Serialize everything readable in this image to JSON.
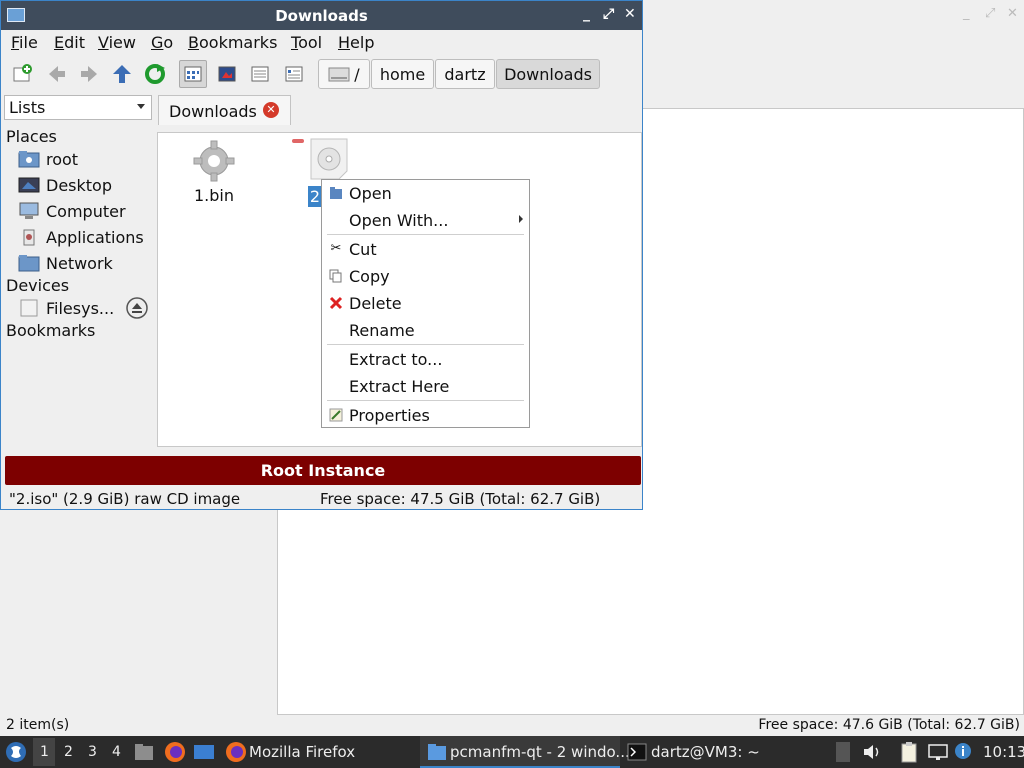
{
  "window": {
    "title": "Downloads",
    "controls": [
      "_",
      "⤢",
      "✕"
    ]
  },
  "menubar": [
    "File",
    "Edit",
    "View",
    "Go",
    "Bookmarks",
    "Tool",
    "Help"
  ],
  "menubar_mnemonic": [
    "F",
    "E",
    "V",
    "G",
    "B",
    "T",
    "H"
  ],
  "pathbar": {
    "root": "/",
    "crumbs": [
      "home",
      "dartz",
      "Downloads"
    ]
  },
  "sidepane": {
    "combo": "Lists",
    "places_header": "Places",
    "places": [
      "root",
      "Desktop",
      "Computer",
      "Applications",
      "Network"
    ],
    "devices_header": "Devices",
    "devices": [
      "Filesys..."
    ],
    "bookmarks_header": "Bookmarks"
  },
  "tab": {
    "label": "Downloads"
  },
  "files": [
    {
      "name": "1.bin",
      "icon": "gear-file-icon"
    },
    {
      "name": "2",
      "icon": "cd-image-icon",
      "selected": true
    }
  ],
  "context_menu": {
    "items": [
      "Open",
      "Open With...",
      "Cut",
      "Copy",
      "Delete",
      "Rename",
      "Extract to...",
      "Extract Here",
      "Properties"
    ]
  },
  "banner": "Root Instance",
  "status": {
    "left": "\"2.iso\" (2.9 GiB) raw CD image",
    "right": "Free space: 47.5 GiB (Total: 62.7 GiB)"
  },
  "bg_window": {
    "status_left": "2 item(s)",
    "status_right": "Free space: 47.6 GiB (Total: 62.7 GiB)"
  },
  "taskbar": {
    "workspaces": [
      "1",
      "2",
      "3",
      "4"
    ],
    "tasks": [
      "Mozilla Firefox",
      "pcmanfm-qt - 2 windo...",
      "dartz@VM3: ~"
    ],
    "clock": "10:13"
  },
  "colors": {
    "titlebar": "#3f4c5c",
    "banner": "#7d0000",
    "selection": "#3b84c9",
    "taskbar": "#2b2b2b"
  }
}
